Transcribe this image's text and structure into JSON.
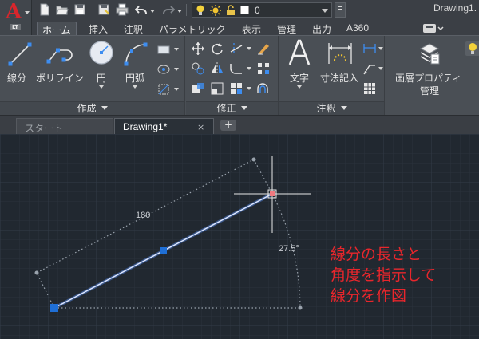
{
  "app": {
    "logo_letter": "A",
    "edition_badge": "LT",
    "document_title": "Drawing1.",
    "current_layer": "0"
  },
  "quick_access": [
    "new-icon",
    "open-icon",
    "save-icon",
    "saveas-icon",
    "print-icon",
    "undo-icon",
    "redo-icon"
  ],
  "ribbon_tabs": [
    {
      "label": "ホーム",
      "active": true
    },
    {
      "label": "挿入"
    },
    {
      "label": "注釈"
    },
    {
      "label": "パラメトリック"
    },
    {
      "label": "表示"
    },
    {
      "label": "管理"
    },
    {
      "label": "出力"
    },
    {
      "label": "A360"
    }
  ],
  "panels": {
    "draw": {
      "title": "作成",
      "tools": [
        "線分",
        "ポリライン",
        "円",
        "円弧"
      ]
    },
    "modify": {
      "title": "修正"
    },
    "annotation": {
      "title": "注釈",
      "tools": [
        "文字",
        "寸法記入"
      ]
    },
    "layers": {
      "tool_line1": "画層プロパティ",
      "tool_line2": "管理"
    }
  },
  "file_tabs": {
    "start": "スタート",
    "drawing": "Drawing1*",
    "close_glyph": "×",
    "new_glyph": "+"
  },
  "drawing": {
    "length_dim": "180",
    "angle_dim": "27.5°",
    "length_value": 180,
    "angle_value_deg": 27.5,
    "annotation_lines": [
      "線分の長さと",
      "角度を指示して",
      "線分を作図"
    ],
    "colors": {
      "background": "#212830",
      "line": "#7ea4e8",
      "grip": "#1f6fd6",
      "annotation": "#e8262c"
    }
  }
}
